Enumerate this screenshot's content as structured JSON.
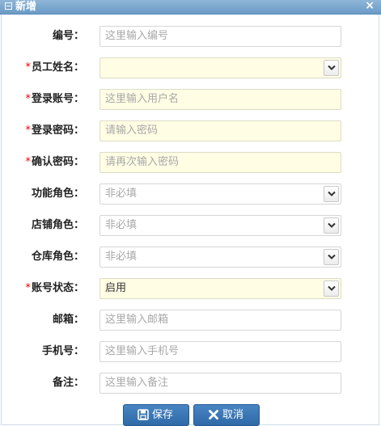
{
  "dialog": {
    "title": "新增",
    "close_symbol": "×"
  },
  "form": {
    "required_mark": "*",
    "fields": [
      {
        "label": "编号：",
        "required": false,
        "type": "input",
        "placeholder": "这里输入编号",
        "value": ""
      },
      {
        "label": "员工姓名：",
        "required": true,
        "type": "select",
        "placeholder": "",
        "value": ""
      },
      {
        "label": "登录账号：",
        "required": true,
        "type": "input",
        "placeholder": "这里输入用户名",
        "value": ""
      },
      {
        "label": "登录密码：",
        "required": true,
        "type": "input",
        "placeholder": "请输入密码",
        "value": ""
      },
      {
        "label": "确认密码：",
        "required": true,
        "type": "input",
        "placeholder": "请再次输入密码",
        "value": ""
      },
      {
        "label": "功能角色：",
        "required": false,
        "type": "select",
        "placeholder": "非必填",
        "value": ""
      },
      {
        "label": "店铺角色：",
        "required": false,
        "type": "select",
        "placeholder": "非必填",
        "value": ""
      },
      {
        "label": "仓库角色：",
        "required": false,
        "type": "select",
        "placeholder": "非必填",
        "value": ""
      },
      {
        "label": "账号状态：",
        "required": true,
        "type": "select",
        "placeholder": "",
        "value": "启用"
      },
      {
        "label": "邮箱：",
        "required": false,
        "type": "input",
        "placeholder": "这里输入邮箱",
        "value": ""
      },
      {
        "label": "手机号：",
        "required": false,
        "type": "input",
        "placeholder": "这里输入手机号",
        "value": ""
      },
      {
        "label": "备注：",
        "required": false,
        "type": "input",
        "placeholder": "这里输入备注",
        "value": ""
      }
    ]
  },
  "buttons": {
    "save": "保存",
    "cancel": "取消"
  },
  "icons": {
    "title": "window-icon",
    "close": "close-icon",
    "save": "save-icon",
    "cancel": "cancel-icon",
    "dropdown": "chevron-down-icon"
  },
  "colors": {
    "required": "#ee0000",
    "button": "#3a76b6",
    "required_field_bg": "#fffde4"
  }
}
